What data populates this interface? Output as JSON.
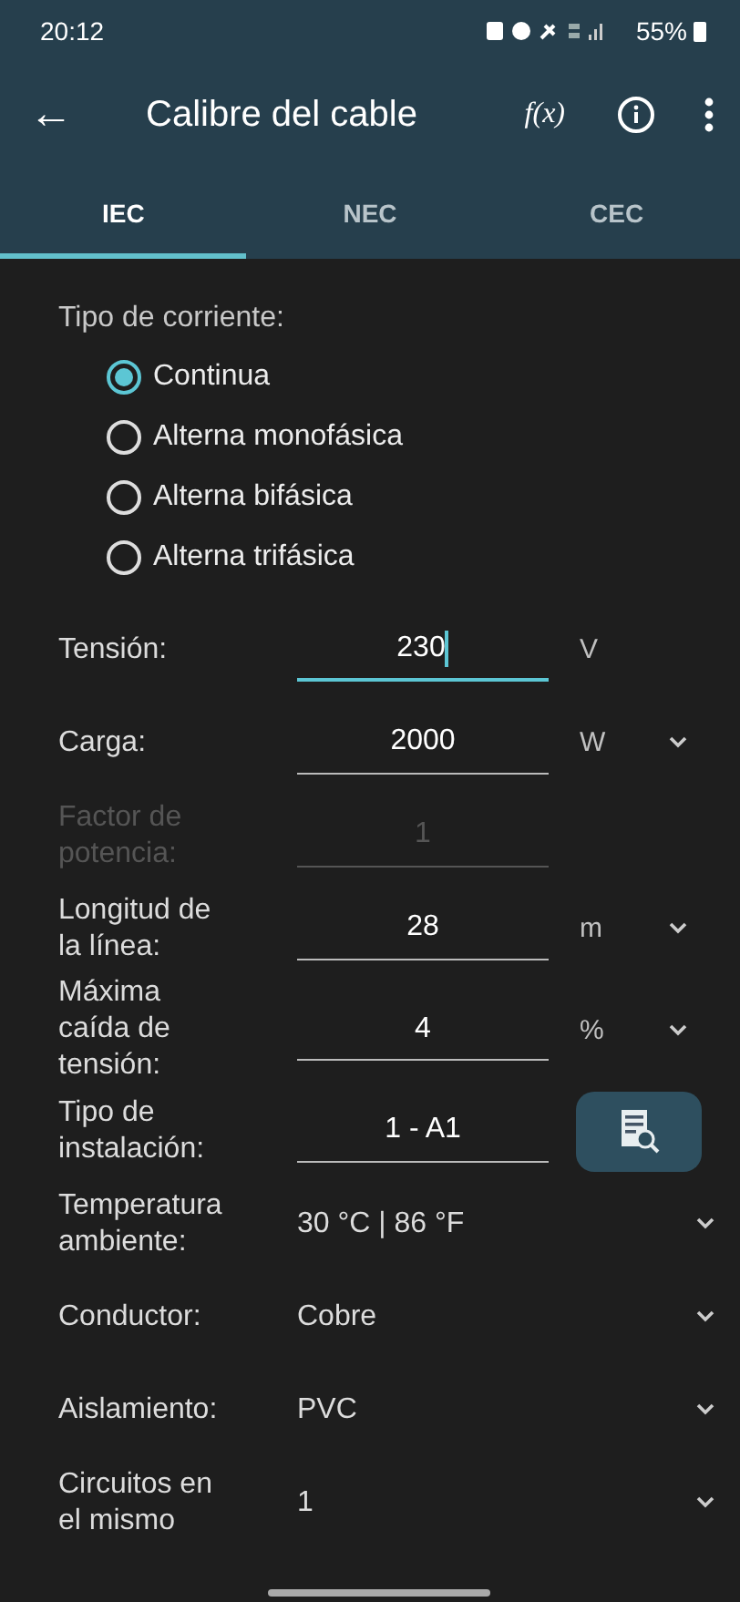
{
  "status_bar": {
    "time": "20:12",
    "battery": "55%"
  },
  "toolbar": {
    "back": "←",
    "title": "Calibre del cable",
    "formula": "f(x)"
  },
  "tabs": [
    {
      "label": "IEC",
      "selected": true
    },
    {
      "label": "NEC",
      "selected": false
    },
    {
      "label": "CEC",
      "selected": false
    }
  ],
  "current_type": {
    "label": "Tipo de corriente:",
    "options": [
      {
        "label": "Continua",
        "selected": true
      },
      {
        "label": "Alterna monofásica",
        "selected": false
      },
      {
        "label": "Alterna bifásica",
        "selected": false
      },
      {
        "label": "Alterna trifásica",
        "selected": false
      }
    ]
  },
  "fields": [
    {
      "kind": "input",
      "label": "Tensión:",
      "value": "230",
      "unit": "V",
      "dropdown": false,
      "focused": true,
      "disabled": false
    },
    {
      "kind": "input",
      "label": "Carga:",
      "value": "2000",
      "unit": "W",
      "dropdown": true,
      "focused": false,
      "disabled": false
    },
    {
      "kind": "input",
      "label": "Factor de potencia:",
      "value": "1",
      "dropdown": false,
      "focused": false,
      "disabled": true
    },
    {
      "kind": "input",
      "label": "Longitud de la línea:",
      "value": "28",
      "unit": "m",
      "dropdown": true,
      "focused": false,
      "disabled": false
    },
    {
      "kind": "input",
      "label": "Máxima caída de tensión:",
      "value": "4",
      "unit": "%",
      "dropdown": true,
      "focused": false,
      "disabled": false
    },
    {
      "kind": "lookup",
      "label": "Tipo de instalación:",
      "value": "1 - A1"
    },
    {
      "kind": "select",
      "label": "Temperatura ambiente:",
      "value": "30 °C | 86 °F"
    },
    {
      "kind": "select",
      "label": "Conductor:",
      "value": "Cobre"
    },
    {
      "kind": "select",
      "label": "Aislamiento:",
      "value": "PVC"
    },
    {
      "kind": "select",
      "label": "Circuitos en el mismo",
      "value": "1"
    }
  ]
}
